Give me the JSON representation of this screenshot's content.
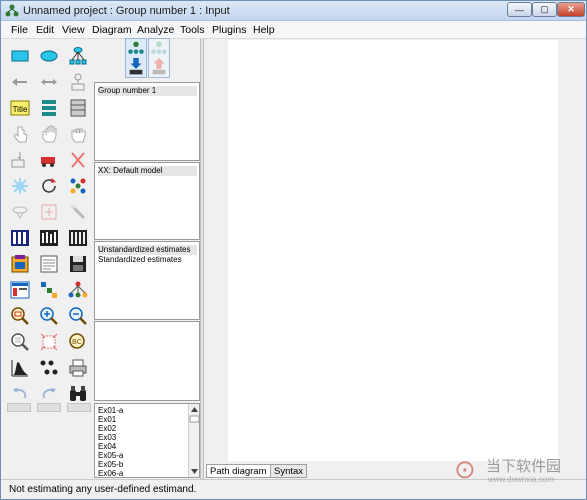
{
  "window": {
    "title": "Unnamed project : Group number 1 : Input",
    "controls": {
      "minimize": "—",
      "maximize": "▢",
      "close": "✕"
    }
  },
  "menu": [
    "File",
    "Edit",
    "View",
    "Diagram",
    "Analyze",
    "Tools",
    "Plugins",
    "Help"
  ],
  "toolbox": {
    "icons": [
      "draw-observed-variable-icon",
      "draw-unobserved-variable-icon",
      "draw-indicator-variable-icon",
      "draw-path-icon",
      "draw-covariance-icon",
      "add-unique-variable-icon",
      "title-icon",
      "list-variables-in-model-icon",
      "list-variables-in-dataset-icon",
      "select-one-object-icon",
      "select-all-objects-icon",
      "deselect-all-objects-icon",
      "duplicate-objects-icon",
      "move-objects-icon",
      "erase-objects-icon",
      "change-shape-icon",
      "rotate-indicators-icon",
      "reflect-indicators-icon",
      "move-parameter-values-icon",
      "reposition-diagram-icon",
      "touch-up-variable-icon",
      "select-data-files-icon",
      "analysis-properties-icon",
      "calculate-estimates-icon",
      "copy-diagram-icon",
      "view-text-output-icon",
      "save-diagram-icon",
      "object-properties-icon",
      "drag-properties-icon",
      "preserve-symmetries-icon",
      "zoom-in-area-icon",
      "zoom-in-icon",
      "zoom-out-icon",
      "show-entire-page-icon",
      "resize-diagram-icon",
      "magnifier-icon",
      "bayesian-estimation-icon",
      "multiple-group-analysis-icon",
      "print-icon",
      "undo-icon",
      "redo-icon",
      "specification-search-icon"
    ],
    "title_tool_label": "Title"
  },
  "mode_buttons": [
    "view-input-path-diagram-icon",
    "view-output-path-diagram-icon"
  ],
  "panels": {
    "groups": [
      "Group number 1"
    ],
    "models": [
      "XX: Default model"
    ],
    "estimates": [
      "Unstandardized estimates",
      "Standardized estimates"
    ],
    "files": [
      "Ex01-a",
      "Ex01",
      "Ex02",
      "Ex03",
      "Ex04",
      "Ex05-a",
      "Ex05-b",
      "Ex06-a"
    ]
  },
  "tabs": {
    "path_diagram": "Path diagram",
    "syntax": "Syntax"
  },
  "status": "Not estimating any user-defined estimand.",
  "watermark": {
    "glyph": "⊙",
    "text": "当下软件园",
    "url": "www.downxia.com"
  },
  "colors": {
    "titlebar": "#c3d6ee",
    "accent": "#1f6fb8",
    "selection": "#e6e6e6"
  }
}
